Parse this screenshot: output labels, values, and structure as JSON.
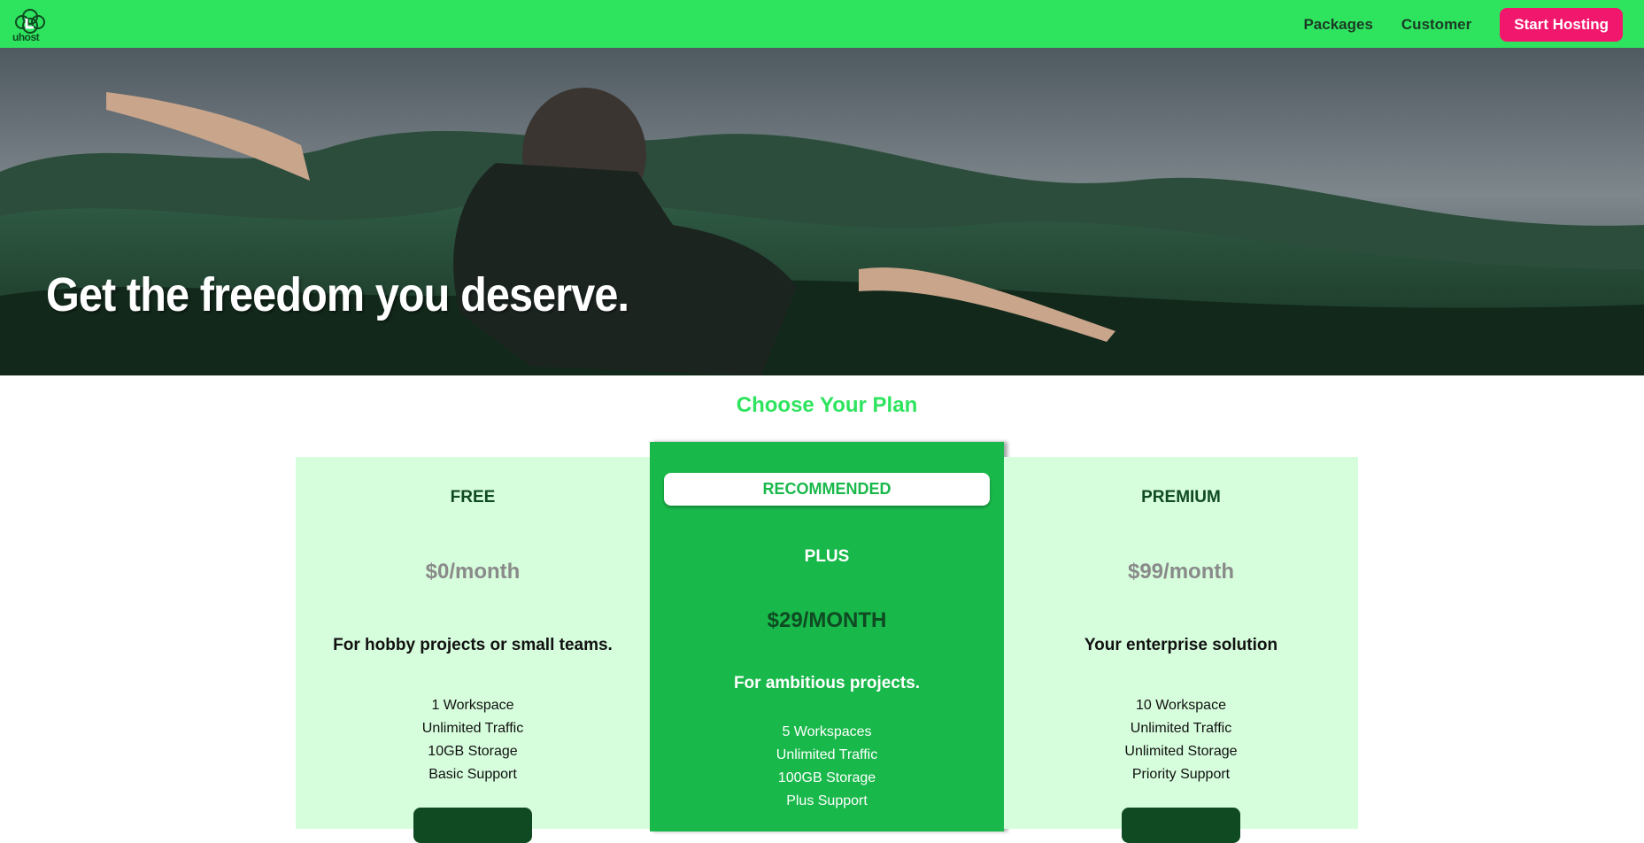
{
  "brand": {
    "logo_icon": "cloud-logo-icon",
    "logo_text": "uhost"
  },
  "nav": {
    "links": [
      "Packages",
      "Customer"
    ],
    "cta": "Start Hosting"
  },
  "hero": {
    "title": "Get the freedom you deserve."
  },
  "plans": {
    "title": "Choose Your Plan",
    "badge": "RECOMMENDED",
    "items": [
      {
        "name": "FREE",
        "price": "$0/month",
        "description": "For hobby projects or small teams.",
        "features": [
          "1 Workspace",
          "Unlimited Traffic",
          "10GB Storage",
          "Basic Support"
        ]
      },
      {
        "name": "PLUS",
        "price": "$29/MONTH",
        "description": "For ambitious projects.",
        "features": [
          "5 Workspaces",
          "Unlimited Traffic",
          "100GB Storage",
          "Plus Support"
        ]
      },
      {
        "name": "PREMIUM",
        "price": "$99/month",
        "description": "Your enterprise solution",
        "features": [
          "10 Workspace",
          "Unlimited Traffic",
          "Unlimited Storage",
          "Priority Support"
        ]
      }
    ]
  },
  "colors": {
    "topbar": "#2ee45e",
    "cta": "#f1176d",
    "card": "#d6fddc",
    "card_recommended": "#19b84a",
    "dark_green": "#0f4a22"
  }
}
